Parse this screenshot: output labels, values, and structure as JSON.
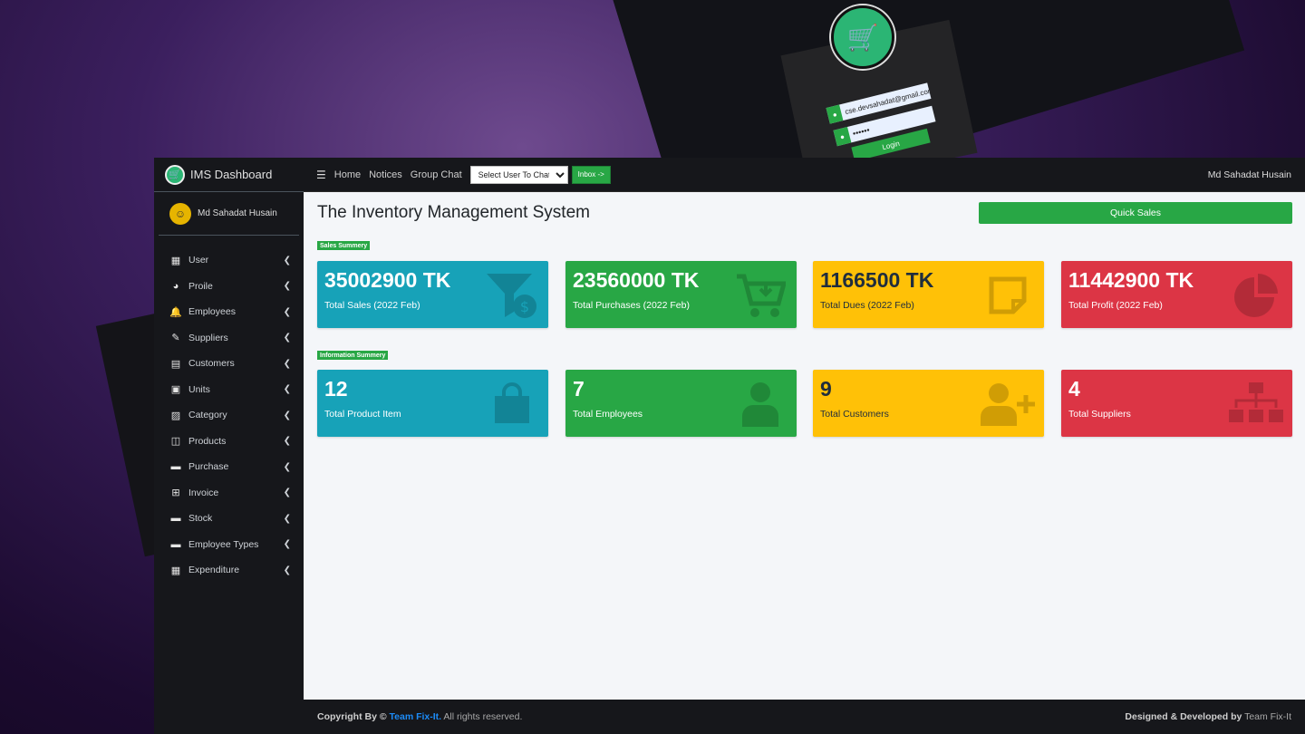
{
  "promo": {
    "login_email": "cse.devsahadat@gmail.com",
    "login_password": "••••••",
    "login_button": "Login"
  },
  "brand": {
    "title": "IMS Dashboard"
  },
  "user_panel": {
    "name": "Md Sahadat Husain"
  },
  "sidebar": {
    "items": [
      {
        "label": "User",
        "icon": "grid-icon"
      },
      {
        "label": "Proile",
        "icon": "chart-pie-icon"
      },
      {
        "label": "Employees",
        "icon": "bell-icon"
      },
      {
        "label": "Suppliers",
        "icon": "edit-icon"
      },
      {
        "label": "Customers",
        "icon": "table-icon"
      },
      {
        "label": "Units",
        "icon": "calendar-icon"
      },
      {
        "label": "Category",
        "icon": "image-icon"
      },
      {
        "label": "Products",
        "icon": "columns-icon"
      },
      {
        "label": "Purchase",
        "icon": "book-icon"
      },
      {
        "label": "Invoice",
        "icon": "plus-square-icon"
      },
      {
        "label": "Stock",
        "icon": "book-icon"
      },
      {
        "label": "Employee Types",
        "icon": "book-icon"
      },
      {
        "label": "Expenditure",
        "icon": "grid-icon"
      }
    ]
  },
  "topbar": {
    "links": [
      "Home",
      "Notices",
      "Group Chat"
    ],
    "chat_select": "Select User To Chat",
    "inbox": "Inbox ->",
    "user": "Md Sahadat Husain"
  },
  "main": {
    "title": "The Inventory Management System",
    "quick_sales": "Quick Sales",
    "sales_badge": "Sales Summery",
    "info_badge": "Information Summery",
    "sales_cards": [
      {
        "value": "35002900 TK",
        "label": "Total Sales (2022 Feb)",
        "color": "#17a2b8",
        "icon": "funnel-dollar-icon"
      },
      {
        "value": "23560000 TK",
        "label": "Total Purchases (2022 Feb)",
        "color": "#28a745",
        "icon": "cart-arrow-down-icon"
      },
      {
        "value": "1166500 TK",
        "label": "Total Dues (2022 Feb)",
        "color": "#ffc107",
        "icon": "sticky-note-icon"
      },
      {
        "value": "11442900 TK",
        "label": "Total Profit (2022 Feb)",
        "color": "#dc3545",
        "icon": "chart-pie-icon"
      }
    ],
    "info_cards": [
      {
        "value": "12",
        "label": "Total Product Item",
        "color": "#17a2b8",
        "icon": "shopping-bag-icon"
      },
      {
        "value": "7",
        "label": "Total Employees",
        "color": "#28a745",
        "icon": "user-tie-icon"
      },
      {
        "value": "9",
        "label": "Total Customers",
        "color": "#ffc107",
        "icon": "user-plus-icon"
      },
      {
        "value": "4",
        "label": "Total Suppliers",
        "color": "#dc3545",
        "icon": "sitemap-icon"
      }
    ]
  },
  "footer": {
    "copyright_prefix": "Copyright By ©",
    "team": "Team Fix-It.",
    "rights": "All rights reserved.",
    "designed_prefix": "Designed & Developed by",
    "designed_team": "Team Fix-It"
  }
}
